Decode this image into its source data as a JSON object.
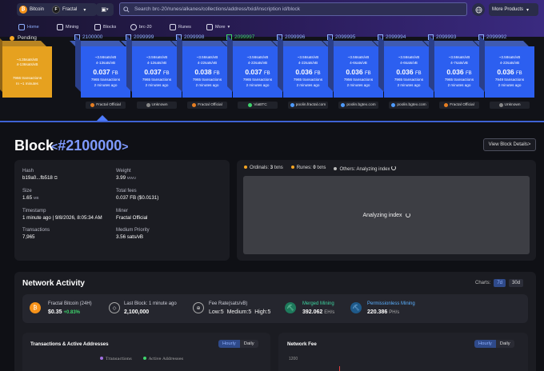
{
  "header": {
    "network_label": "Bitcoin",
    "chain_label": "Fractal",
    "search_placeholder": "Search brc-20/runes/alkanes/collections/address/txid/inscription id/block",
    "more_products_label": "More Products",
    "brand_colors": {
      "bitcoin": "#f7931a",
      "fractal": "#1c1c1c",
      "accent": "#4e7bff"
    }
  },
  "nav": {
    "items": [
      {
        "label": "Home",
        "icon": "home-icon",
        "active": true
      },
      {
        "label": "Mining",
        "icon": "pickaxe-icon"
      },
      {
        "label": "Blocks",
        "icon": "blocks-icon"
      },
      {
        "label": "brc-20",
        "icon": "token-icon"
      },
      {
        "label": "Runes",
        "icon": "runes-icon"
      },
      {
        "label": "More",
        "icon": "chevron-down-icon"
      }
    ]
  },
  "blocks_strip": {
    "pending": {
      "label": "Pending",
      "fee_range": "~4.35sats/vB",
      "fee_span": "4-136sats/vB",
      "txs": "7966 transactions",
      "eta": "In ~1 minutes"
    },
    "blocks": [
      {
        "height": "2100000",
        "fee_median": "~3.56sats/vB",
        "fee_span": "4-13sats/vB",
        "size_value": "0.037",
        "size_unit": "FB",
        "txs": "7965 transactions",
        "age": "2 minutes ago",
        "miner": "Fractal Official",
        "miner_color": "#e67e22"
      },
      {
        "height": "2099999",
        "fee_median": "~3.56sats/vB",
        "fee_span": "4-12sats/vB",
        "size_value": "0.037",
        "size_unit": "FB",
        "txs": "7965 transactions",
        "age": "2 minutes ago",
        "miner": "Unknown",
        "miner_color": "#888888"
      },
      {
        "height": "2099998",
        "fee_median": "~3.56sats/vB",
        "fee_span": "4-22sats/vB",
        "size_value": "0.038",
        "size_unit": "FB",
        "txs": "7965 transactions",
        "age": "2 minutes ago",
        "miner": "Fractal Official",
        "miner_color": "#e67e22"
      },
      {
        "height": "2099997",
        "fee_median": "~3.56sats/vB",
        "fee_span": "4-22sats/vB",
        "size_value": "0.037",
        "size_unit": "FB",
        "txs": "7965 transactions",
        "age": "2 minutes ago",
        "miner": "ViaBTC",
        "miner_color": "#3ed46c",
        "highlight": true
      },
      {
        "height": "2099996",
        "fee_median": "~3.56sats/vB",
        "fee_span": "4-22sats/vB",
        "size_value": "0.036",
        "size_unit": "FB",
        "txs": "7965 transactions",
        "age": "2 minutes ago",
        "miner": "poolin.fractal.com",
        "miner_color": "#4e9bff"
      },
      {
        "height": "2099995",
        "fee_median": "~3.56sats/vB",
        "fee_span": "4-6sats/vB",
        "size_value": "0.036",
        "size_unit": "FB",
        "txs": "7956 transactions",
        "age": "2 minutes ago",
        "miner": "poolin.bgtex.com",
        "miner_color": "#4e9bff"
      },
      {
        "height": "2099994",
        "fee_median": "~3.56sats/vB",
        "fee_span": "4-6sats/vB",
        "size_value": "0.036",
        "size_unit": "FB",
        "txs": "7965 transactions",
        "age": "2 minutes ago",
        "miner": "poolin.bgtex.com",
        "miner_color": "#4e9bff"
      },
      {
        "height": "2099993",
        "fee_median": "~3.56sats/vB",
        "fee_span": "4-7sats/vB",
        "size_value": "0.036",
        "size_unit": "FB",
        "txs": "7965 transactions",
        "age": "2 minutes ago",
        "miner": "Fractal Official",
        "miner_color": "#e67e22"
      },
      {
        "height": "2099992",
        "fee_median": "~3.58sats/vB",
        "fee_span": "4-22sats/vB",
        "size_value": "0.036",
        "size_unit": "FB",
        "txs": "7949 transactions",
        "age": "2 minutes ago",
        "miner": "Unknown",
        "miner_color": "#888888"
      }
    ]
  },
  "block_detail": {
    "title": "Block",
    "number": "#2100000",
    "details_button": "View Block Details>",
    "fields": {
      "hash_label": "Hash",
      "hash_value": "b19a0...fb518",
      "weight_label": "Weight",
      "weight_value": "3.99",
      "weight_unit": "MWU",
      "size_label": "Size",
      "size_value": "1.65",
      "size_unit": "MB",
      "fees_label": "Total fees",
      "fees_value": "0.037 FB ($0.0131)",
      "timestamp_label": "Timestamp",
      "timestamp_value": "1 minute ago | 9/8/2026, 8:05:34 AM",
      "miner_label": "Miner",
      "miner_value": "Fractal Official",
      "txs_label": "Transactions",
      "txs_value": "7,965",
      "priority_label": "Medium Priority",
      "priority_value": "3.56 sats/vB"
    },
    "legend": {
      "ordinals": "Ordinals:",
      "ordinals_count": "3",
      "ordinals_unit": "txns",
      "runes": "Runes:",
      "runes_count": "0",
      "runes_unit": "txns",
      "others": "Others: Analyzing index"
    },
    "analyzing_text": "Analyzing index"
  },
  "network_activity": {
    "title": "Network Activity",
    "charts_label": "Charts:",
    "range_options": [
      "7d",
      "30d"
    ],
    "stats": {
      "coin_label": "Fractal Bitcoin (24H)",
      "coin_price": "$0.35",
      "coin_change": "+0.83%",
      "last_block_label": "Last Block: 1 minute ago",
      "last_block_value": "2,100,000",
      "fee_rate_label": "Fee Rate(sats/vB)",
      "fee_low": "Low:5",
      "fee_medium": "Medium:5",
      "fee_high": "High:5",
      "merged_label": "Merged Mining",
      "merged_value": "392.062",
      "merged_unit": "EH/s",
      "permissionless_label": "Permissionless Mining",
      "permissionless_value": "220.386",
      "permissionless_unit": "PH/s"
    },
    "tx_chart": {
      "title": "Transactions & Active Addresses",
      "toggle": [
        "Hourly",
        "Daily"
      ],
      "legend": [
        "Transactions",
        "Active Addresses"
      ]
    },
    "fee_chart": {
      "title": "Network Fee",
      "toggle": [
        "Hourly",
        "Daily"
      ],
      "y_tick": "1200"
    }
  }
}
